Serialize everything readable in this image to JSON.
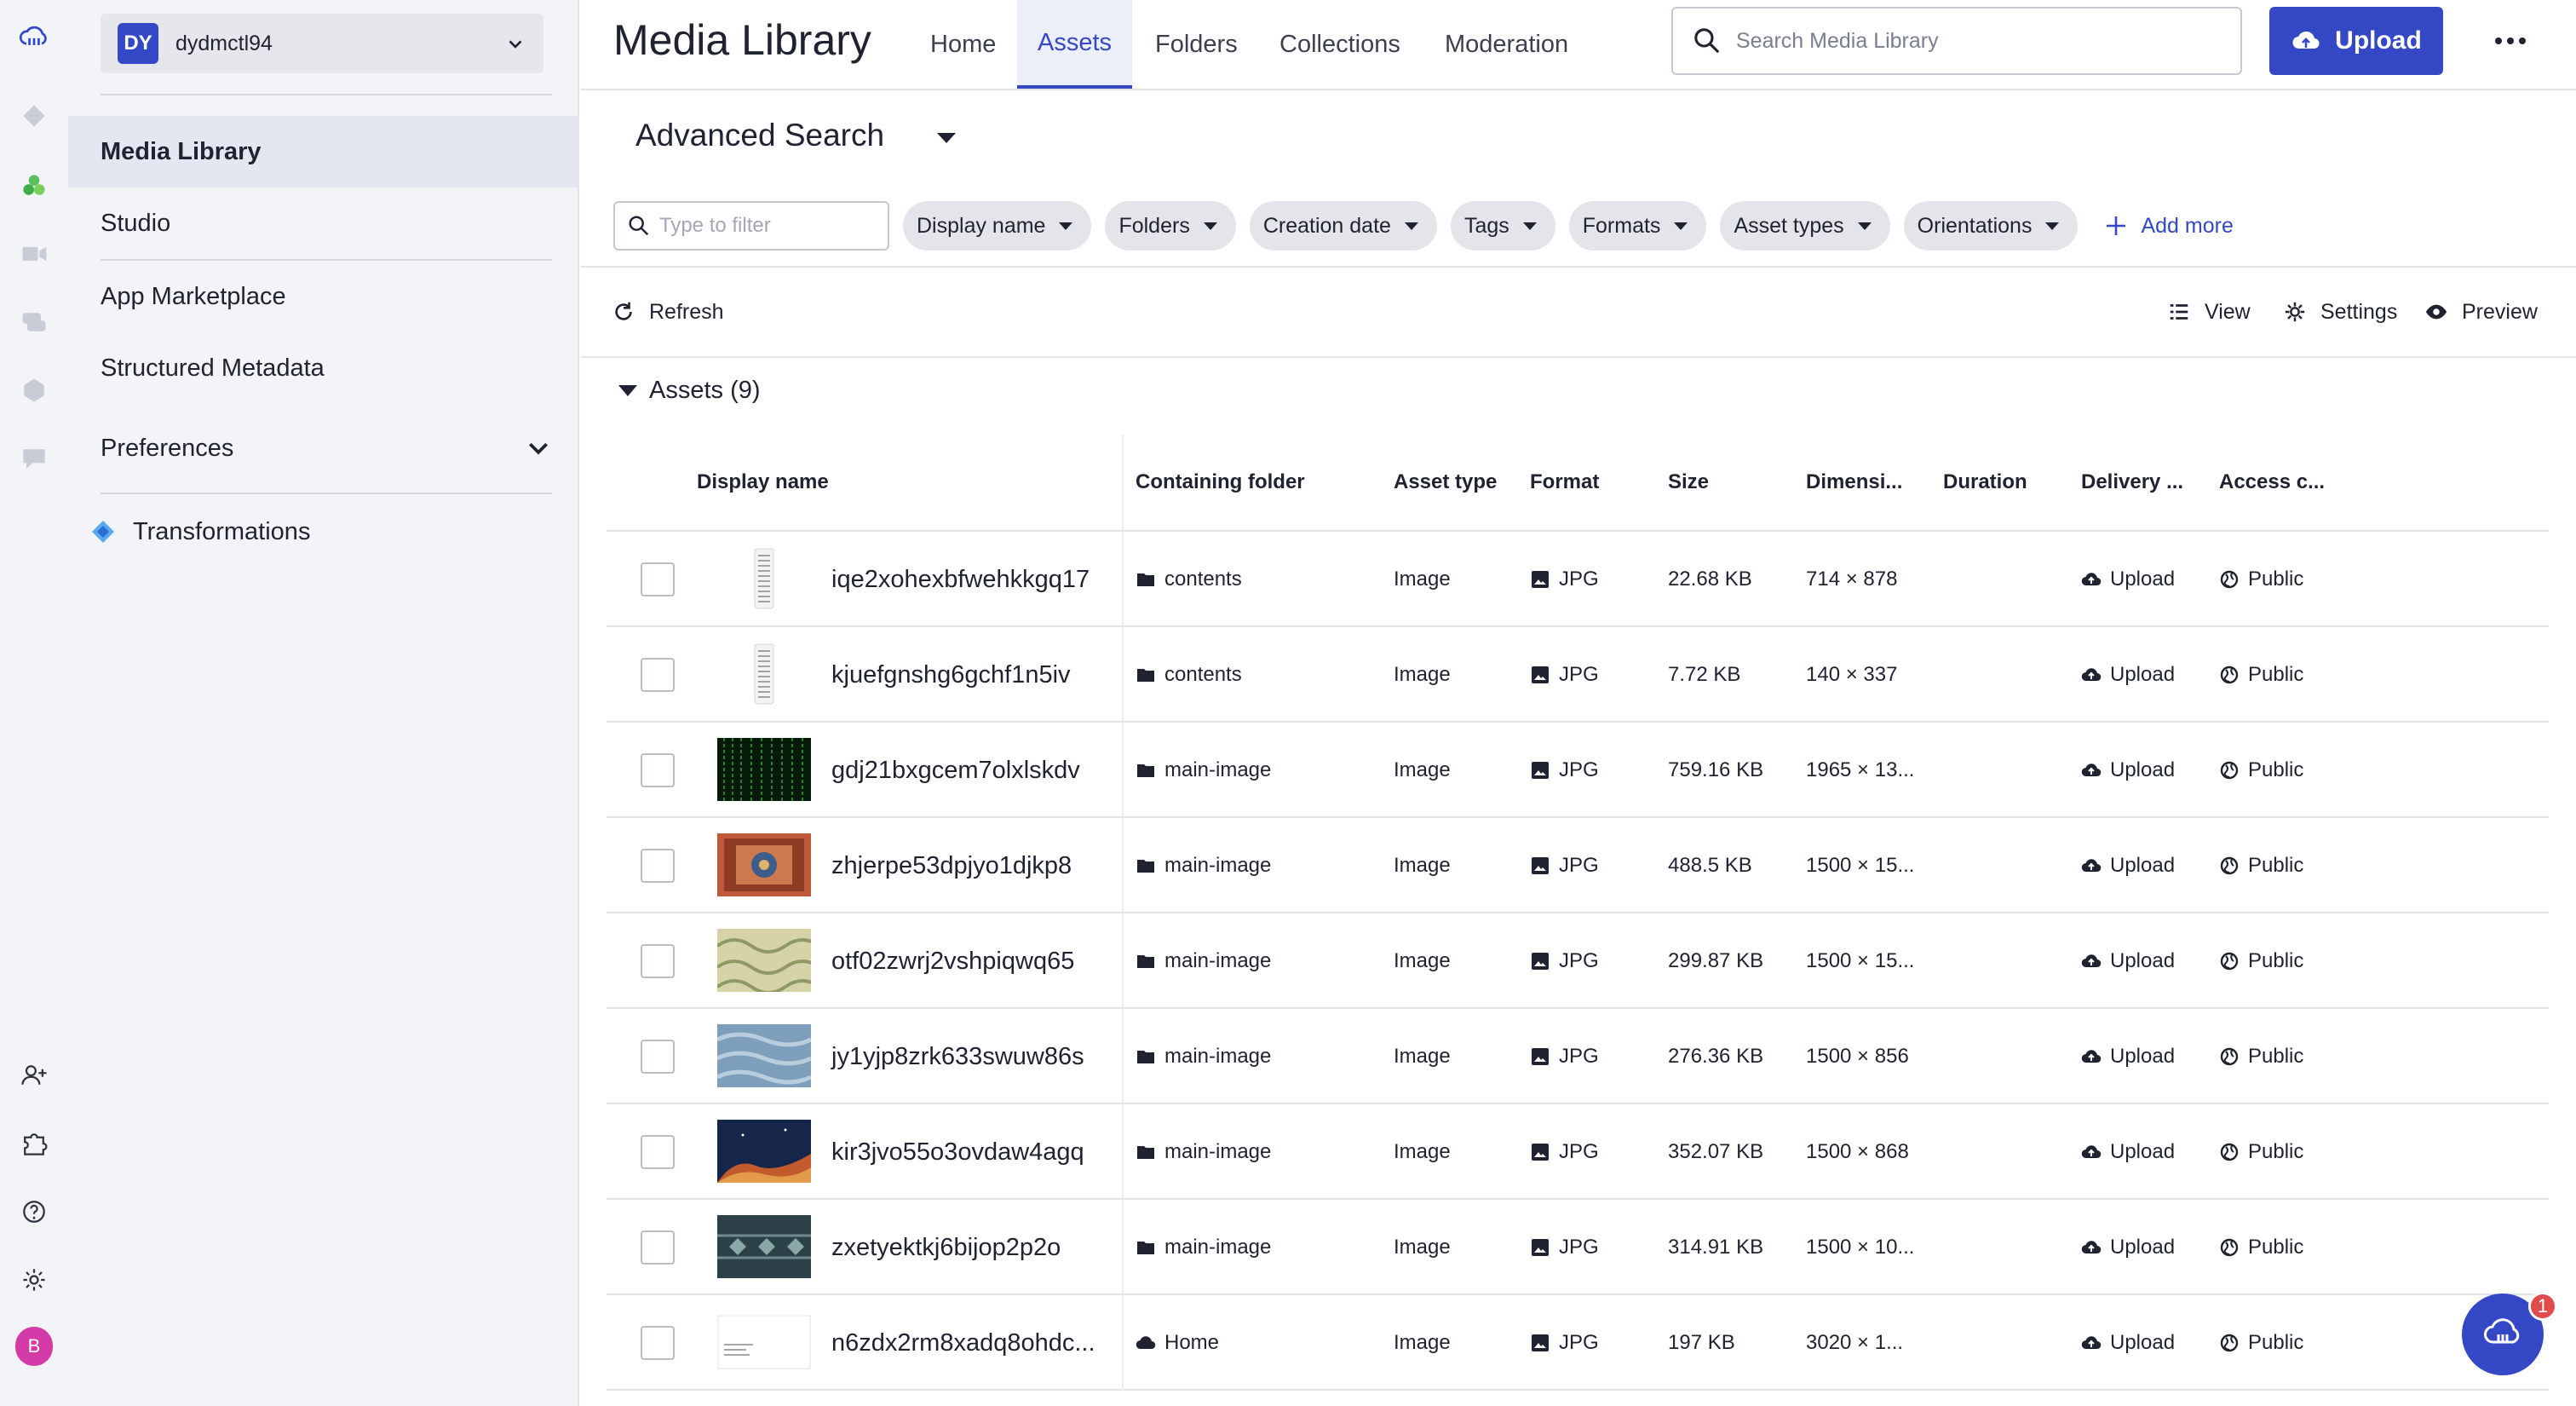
{
  "rail": {
    "icons": [
      "cloudinary-logo-icon",
      "programmable-media-icon",
      "assets-icon",
      "video-icon",
      "conversations-icon",
      "structured-icon",
      "chat-icon",
      "invite-user-icon",
      "puzzle-icon",
      "help-icon",
      "settings-gear-icon"
    ],
    "user_initial": "B"
  },
  "account": {
    "badge": "DY",
    "name": "dydmctl94"
  },
  "sidebar": {
    "items": [
      {
        "label": "Media Library",
        "active": true
      },
      {
        "label": "Studio"
      },
      {
        "label": "App Marketplace"
      },
      {
        "label": "Structured Metadata"
      },
      {
        "label": "Preferences"
      },
      {
        "label": "Transformations"
      }
    ]
  },
  "header": {
    "title": "Media Library",
    "tabs": [
      {
        "label": "Home"
      },
      {
        "label": "Assets",
        "active": true
      },
      {
        "label": "Folders"
      },
      {
        "label": "Collections"
      },
      {
        "label": "Moderation"
      }
    ],
    "search_placeholder": "Search Media Library",
    "upload_label": "Upload"
  },
  "advanced_search": {
    "title": "Advanced Search",
    "filter_placeholder": "Type to filter",
    "chips": [
      "Display name",
      "Folders",
      "Creation date",
      "Tags",
      "Formats",
      "Asset types",
      "Orientations"
    ],
    "add_more": "Add more"
  },
  "toolbar": {
    "refresh": "Refresh",
    "view": "View",
    "settings": "Settings",
    "preview": "Preview"
  },
  "assets": {
    "heading": "Assets (9)",
    "columns": [
      "Display name",
      "Containing folder",
      "Asset type",
      "Format",
      "Size",
      "Dimensi...",
      "Duration",
      "Delivery ...",
      "Access c..."
    ],
    "rows": [
      {
        "name": "iqe2xohexbfwehkkgq17",
        "folder": "contents",
        "folder_icon": "folder-icon",
        "type": "Image",
        "format": "JPG",
        "size": "22.68 KB",
        "dims": "714 × 878",
        "duration": "",
        "delivery": "Upload",
        "access": "Public",
        "thumb": "doc-tall"
      },
      {
        "name": "kjuefgnshg6gchf1n5iv",
        "folder": "contents",
        "folder_icon": "folder-icon",
        "type": "Image",
        "format": "JPG",
        "size": "7.72 KB",
        "dims": "140 × 337",
        "duration": "",
        "delivery": "Upload",
        "access": "Public",
        "thumb": "doc-tall"
      },
      {
        "name": "gdj21bxgcem7olxlskdv",
        "folder": "main-image",
        "folder_icon": "folder-icon",
        "type": "Image",
        "format": "JPG",
        "size": "759.16 KB",
        "dims": "1965 × 13...",
        "duration": "",
        "delivery": "Upload",
        "access": "Public",
        "thumb": "matrix"
      },
      {
        "name": "zhjerpe53dpjyo1djkp8",
        "folder": "main-image",
        "folder_icon": "folder-icon",
        "type": "Image",
        "format": "JPG",
        "size": "488.5 KB",
        "dims": "1500 × 15...",
        "duration": "",
        "delivery": "Upload",
        "access": "Public",
        "thumb": "rug"
      },
      {
        "name": "otf02zwrj2vshpiqwq65",
        "folder": "main-image",
        "folder_icon": "folder-icon",
        "type": "Image",
        "format": "JPG",
        "size": "299.87 KB",
        "dims": "1500 × 15...",
        "duration": "",
        "delivery": "Upload",
        "access": "Public",
        "thumb": "floral"
      },
      {
        "name": "jy1yjp8zrk633swuw86s",
        "folder": "main-image",
        "folder_icon": "folder-icon",
        "type": "Image",
        "format": "JPG",
        "size": "276.36 KB",
        "dims": "1500 × 856",
        "duration": "",
        "delivery": "Upload",
        "access": "Public",
        "thumb": "blue"
      },
      {
        "name": "kir3jvo55o3ovdaw4agq",
        "folder": "main-image",
        "folder_icon": "folder-icon",
        "type": "Image",
        "format": "JPG",
        "size": "352.07 KB",
        "dims": "1500 × 868",
        "duration": "",
        "delivery": "Upload",
        "access": "Public",
        "thumb": "nebula"
      },
      {
        "name": "zxetyektkj6bijop2p2o",
        "folder": "main-image",
        "folder_icon": "folder-icon",
        "type": "Image",
        "format": "JPG",
        "size": "314.91 KB",
        "dims": "1500 × 10...",
        "duration": "",
        "delivery": "Upload",
        "access": "Public",
        "thumb": "damask"
      },
      {
        "name": "n6zdx2rm8xadq8ohdc...",
        "folder": "Home",
        "folder_icon": "cloud-icon",
        "type": "Image",
        "format": "JPG",
        "size": "197 KB",
        "dims": "3020 × 1...",
        "duration": "",
        "delivery": "Upload",
        "access": "Public",
        "thumb": "screenshot"
      }
    ]
  },
  "chat": {
    "badge_count": "1"
  },
  "colors": {
    "accent": "#3448c5",
    "rail_bg": "#f3f4f7",
    "badge_red": "#e24b4b",
    "avatar_pink": "#d43aa8"
  }
}
